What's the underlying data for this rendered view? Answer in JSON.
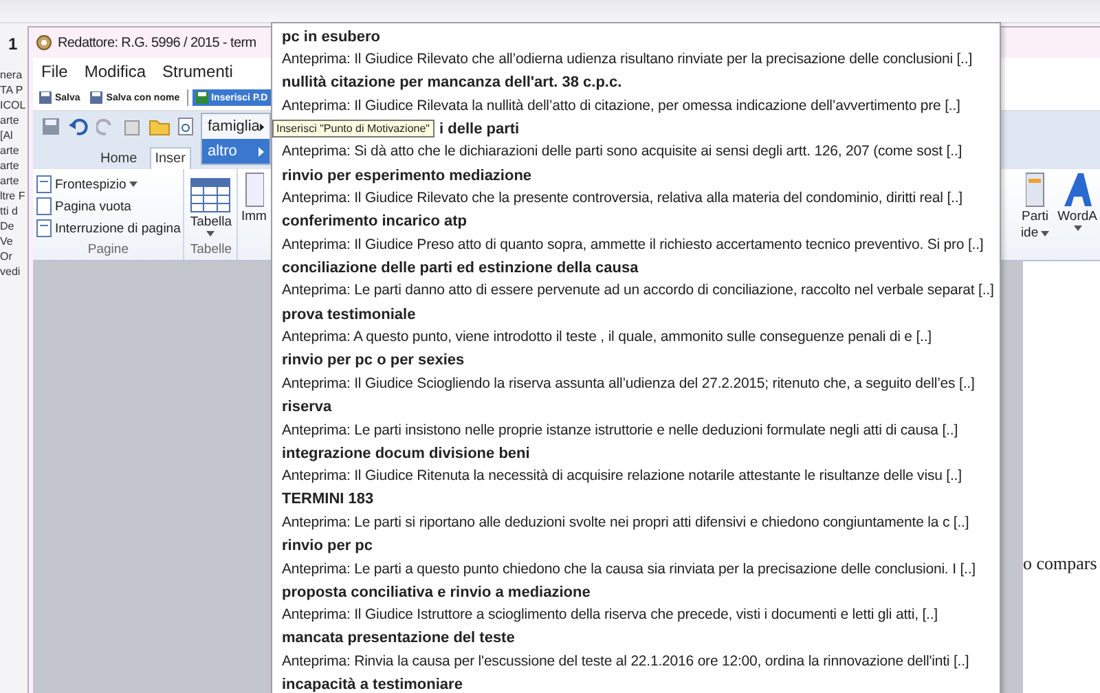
{
  "background_window": {
    "number": "1",
    "edge_labels": [
      "nera",
      "TA P",
      "ICOL",
      "arte",
      "[Al",
      "arte",
      "arte",
      "arte",
      "ltre F",
      "tti d",
      "De",
      "Ve",
      "Or",
      "vedi"
    ]
  },
  "window": {
    "title": "Redattore: R.G. 5996 / 2015 - term"
  },
  "menu_bar": [
    "File",
    "Modifica",
    "Strumenti"
  ],
  "toolbar": [
    {
      "label": "Salva",
      "selected": false
    },
    {
      "label": "Salva con nome",
      "selected": false
    },
    {
      "label": "Inserisci P.D",
      "selected": true
    }
  ],
  "submenu": [
    {
      "label": "famiglia",
      "selected": false
    },
    {
      "label": "altro",
      "selected": true
    }
  ],
  "ribbon_tabs": [
    {
      "label": "Home",
      "selected": false
    },
    {
      "label": "Inser",
      "selected": true
    }
  ],
  "ribbon": {
    "pagine": {
      "items": [
        "Frontespizio",
        "Pagina vuota",
        "Interruzione di pagina"
      ],
      "label": "Pagine"
    },
    "tabelle": {
      "item": "Tabella",
      "label": "Tabelle"
    },
    "image_label": "Imm",
    "parts_label": [
      "Parti",
      "ide"
    ],
    "wordart_label": "WordA"
  },
  "menu_items": [
    {
      "title": "pc in esubero",
      "preview": "Anteprima: Il Giudice Rilevato che all’odierna udienza risultano rinviate per la precisazione delle conclusioni [..]"
    },
    {
      "title": "nullità citazione per mancanza dell'art. 38 c.p.c.",
      "preview": "Anteprima: Il Giudice Rilevata la nullità dell’atto di citazione, per omessa indicazione dell’avvertimento pre [..]"
    },
    {
      "title": "i delle parti",
      "tooltip": "Inserisci \"Punto di Motivazione\"",
      "preview": "Anteprima: Si dà atto che le dichiarazioni delle parti sono acquisite ai sensi degli artt. 126, 207 (come sost [..]"
    },
    {
      "title": "rinvio per esperimento mediazione",
      "preview": "Anteprima: Il Giudice Rilevato che la presente controversia, relativa alla materia del condominio, diritti real [..]"
    },
    {
      "title": "conferimento incarico atp",
      "preview": "Anteprima: Il Giudice Preso atto di quanto sopra, ammette il richiesto accertamento tecnico preventivo. Si pro [..]"
    },
    {
      "title": "conciliazione delle parti ed estinzione della causa",
      "preview": "Anteprima: Le parti danno atto di essere pervenute ad un accordo di conciliazione, raccolto nel verbale separat [..]"
    },
    {
      "title": "prova testimoniale",
      "preview": "Anteprima: A questo punto, viene introdotto il teste , il quale, ammonito sulle conseguenze penali di e [..]"
    },
    {
      "title": "rinvio per pc o per sexies",
      "preview": "Anteprima: Il Giudice Sciogliendo la riserva assunta all’udienza del 27.2.2015; ritenuto che, a seguito dell’es [..]"
    },
    {
      "title": "riserva",
      "preview": "Anteprima: Le parti insistono nelle proprie istanze istruttorie e nelle deduzioni formulate negli atti di causa [..]"
    },
    {
      "title": "integrazione docum divisione beni",
      "preview": "Anteprima: Il Giudice Ritenuta la necessità di acquisire relazione notarile attestante le risultanze delle visu [..]"
    },
    {
      "title": "TERMINI 183",
      "preview": "Anteprima: Le parti si riportano alle deduzioni svolte nei propri atti difensivi e chiedono congiuntamente la c [..]"
    },
    {
      "title": "rinvio per pc",
      "preview": "Anteprima: Le parti a questo punto chiedono che la causa sia rinviata per la precisazione delle conclusioni. I [..]"
    },
    {
      "title": "proposta conciliativa e rinvio a mediazione",
      "preview": "Anteprima: Il Giudice Istruttore a scioglimento della riserva che precede, visti i documenti e letti gli atti, [..]"
    },
    {
      "title": "mancata presentazione del teste",
      "preview": "Anteprima: Rinvia la causa per l'escussione del teste al 22.1.2016 ore 12:00, ordina la rinnovazione dell'inti [..]"
    },
    {
      "title": "incapacità a testimoniare"
    }
  ],
  "document": {
    "text": "o compars"
  }
}
